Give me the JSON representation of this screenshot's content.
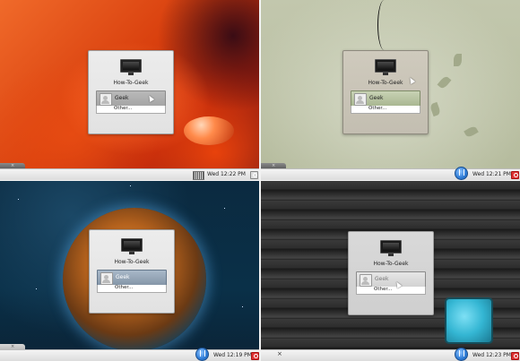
{
  "screens": [
    {
      "hostname": "How-To-Geek",
      "user": "Geek",
      "other": "Other...",
      "clock": "Wed 12:22 PM"
    },
    {
      "hostname": "How-To-Geek",
      "user": "Geek",
      "other": "Other...",
      "clock": "Wed 12:21 PM"
    },
    {
      "hostname": "How-To-Geek",
      "user": "Geek",
      "other": "Other...",
      "clock": "Wed 12:19 PM"
    },
    {
      "hostname": "How-To-Geek",
      "user": "Geek",
      "other": "Other...",
      "clock": "Wed 12:23 PM"
    }
  ],
  "icons": {
    "computer": "computer-icon",
    "avatar": "user-avatar-icon",
    "accessibility": "accessibility-icon",
    "shutdown": "shutdown-icon",
    "keyboard": "keyboard-icon"
  },
  "colors": {
    "panel": "#dcdcdc",
    "shutdown": "#d33333",
    "accessibility": "#2f7cd6"
  }
}
